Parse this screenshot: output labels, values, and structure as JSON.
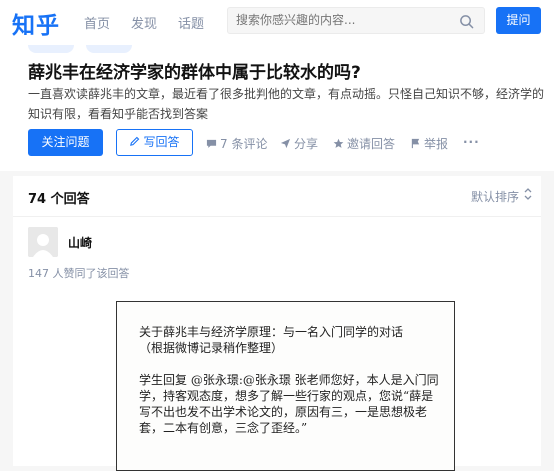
{
  "header": {
    "logo": "知乎",
    "nav": [
      "首页",
      "发现",
      "话题"
    ],
    "search_placeholder": "搜索你感兴趣的内容...",
    "ask_label": "提问"
  },
  "question": {
    "title": "薛兆丰在经济学家的群体中属于比较水的吗?",
    "description": "一直喜欢读薛兆丰的文章，最近看了很多批判他的文章，有点动摇。只怪自己知识不够，经济学的知识有限，看看知乎能否找到答案",
    "follow_label": "关注问题",
    "write_label": "写回答",
    "comments_label": "7 条评论",
    "share_label": "分享",
    "invite_label": "邀请回答",
    "report_label": "举报",
    "more_label": "···"
  },
  "answers": {
    "count_label": "74 个回答",
    "sort_label": "默认排序",
    "first": {
      "author": "山崎",
      "likes": "147 人赞同了该回答",
      "image_text": "关于薛兆丰与经济学原理：与一名入门同学的对话\n（根据微博记录稍作整理）\n\n学生回复 @张永璟:@张永璟 张老师您好，本人是入门同学，持客观态度，想多了解一些行家的观点，您说“薛是写不出也发不出学术论文的，原因有三，一是思想极老套，二本有创意，三念了歪经。”"
    }
  }
}
